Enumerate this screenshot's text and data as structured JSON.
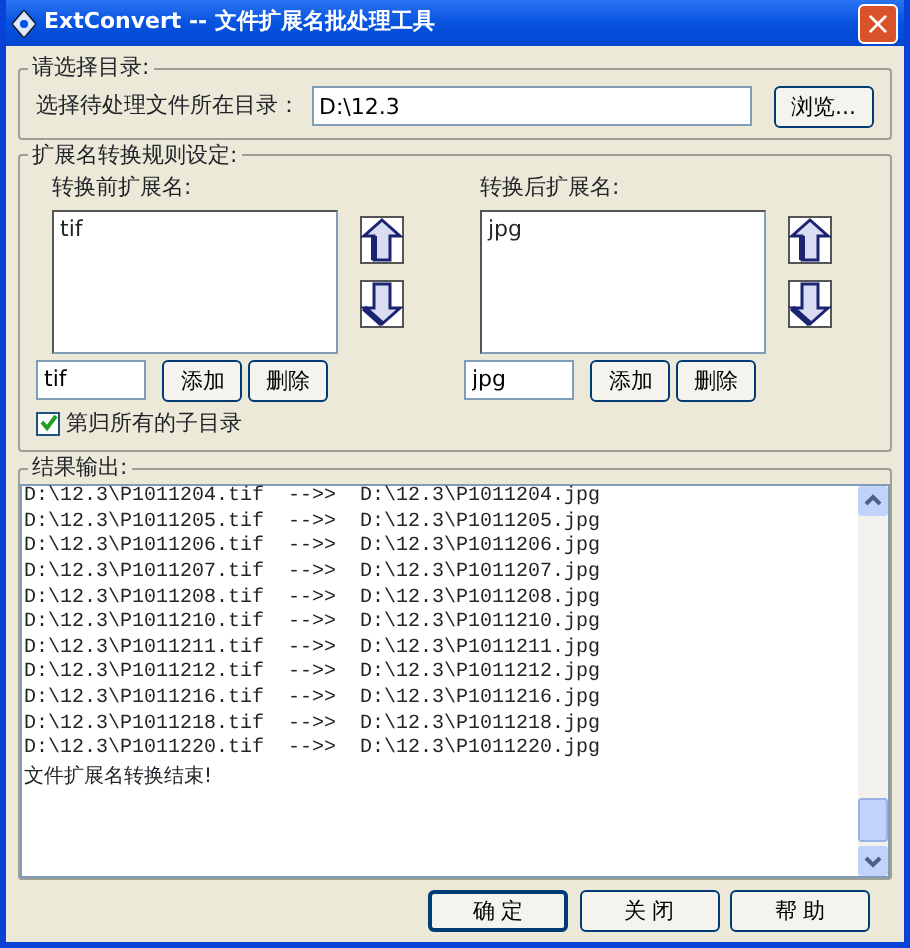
{
  "window": {
    "title": "ExtConvert -- 文件扩展名批处理工具",
    "close": "×"
  },
  "directory": {
    "legend": "请选择目录:",
    "label": "选择待处理文件所在目录：",
    "value": "D:\\12.3",
    "browse": "浏览..."
  },
  "rules": {
    "legend": "扩展名转换规则设定:",
    "lists": [
      {
        "label": "转换前扩展名:",
        "items": [
          "tif"
        ],
        "input": "tif",
        "add": "添加",
        "remove": "删除"
      },
      {
        "label": "转换后扩展名:",
        "items": [
          "jpg"
        ],
        "input": "jpg",
        "add": "添加",
        "remove": "删除"
      }
    ],
    "recursive": {
      "label": "第归所有的子目录",
      "checked": true
    }
  },
  "output": {
    "legend": "结果输出:",
    "lines": [
      "D:\\12.3\\P1011204.tif  -->>  D:\\12.3\\P1011204.jpg",
      "D:\\12.3\\P1011205.tif  -->>  D:\\12.3\\P1011205.jpg",
      "D:\\12.3\\P1011206.tif  -->>  D:\\12.3\\P1011206.jpg",
      "D:\\12.3\\P1011207.tif  -->>  D:\\12.3\\P1011207.jpg",
      "D:\\12.3\\P1011208.tif  -->>  D:\\12.3\\P1011208.jpg",
      "D:\\12.3\\P1011210.tif  -->>  D:\\12.3\\P1011210.jpg",
      "D:\\12.3\\P1011211.tif  -->>  D:\\12.3\\P1011211.jpg",
      "D:\\12.3\\P1011212.tif  -->>  D:\\12.3\\P1011212.jpg",
      "D:\\12.3\\P1011216.tif  -->>  D:\\12.3\\P1011216.jpg",
      "D:\\12.3\\P1011218.tif  -->>  D:\\12.3\\P1011218.jpg",
      "D:\\12.3\\P1011220.tif  -->>  D:\\12.3\\P1011220.jpg"
    ],
    "summary": "文件扩展名转换结束!"
  },
  "buttons": [
    {
      "label": "确 定",
      "default": true
    },
    {
      "label": "关 闭",
      "default": false
    },
    {
      "label": "帮 助",
      "default": false
    }
  ]
}
